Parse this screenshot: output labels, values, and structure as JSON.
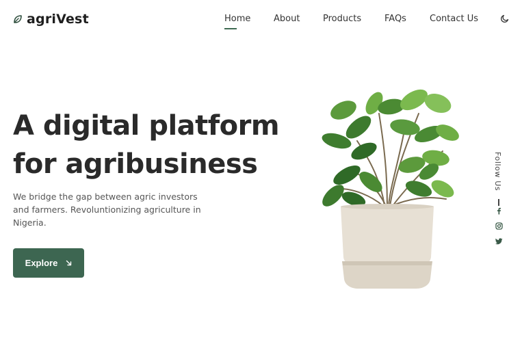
{
  "brand": {
    "name": "agriVest",
    "accent_color": "#3d6651",
    "logo_icon": "leaf-icon"
  },
  "nav": {
    "items": [
      {
        "label": "Home",
        "active": true
      },
      {
        "label": "About",
        "active": false
      },
      {
        "label": "Products",
        "active": false
      },
      {
        "label": "FAQs",
        "active": false
      },
      {
        "label": "Contact Us",
        "active": false
      }
    ],
    "theme_icon": "moon-icon"
  },
  "hero": {
    "title_line1": "A digital platform",
    "title_line2": "for agribusiness",
    "description": "We bridge the gap between agric investors and farmers. Revoluntionizing agriculture in Nigeria.",
    "button_label": "Explore",
    "button_icon": "arrow-down-right-icon",
    "image": "potted-plant-image"
  },
  "social": {
    "label": "Follow Us",
    "icons": [
      "facebook-icon",
      "instagram-icon",
      "twitter-icon"
    ]
  }
}
